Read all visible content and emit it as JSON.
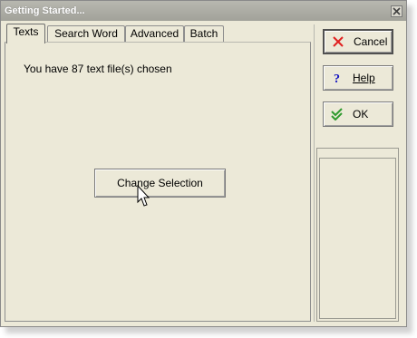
{
  "window": {
    "title": "Getting Started..."
  },
  "tabs": [
    {
      "label": "Texts",
      "active": true
    },
    {
      "label": "Search Word",
      "active": false
    },
    {
      "label": "Advanced",
      "active": false
    },
    {
      "label": "Batch",
      "active": false
    }
  ],
  "texts_panel": {
    "info": "You have 87 text file(s) chosen",
    "change_selection_label": "Change Selection"
  },
  "buttons": {
    "cancel_label": "Cancel",
    "help_label": "Help",
    "ok_label": "OK"
  },
  "colors": {
    "window_bg": "#ece9d8",
    "cancel_icon": "#e02020",
    "help_icon": "#1010c0",
    "ok_icon": "#2f9a2f"
  }
}
